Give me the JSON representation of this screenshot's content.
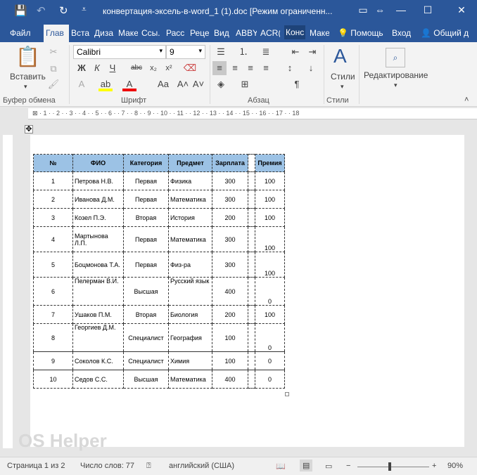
{
  "title": "конвертация-эксель-в-word_1 (1).doc [Режим ограниченн...",
  "tabs": [
    "Файл",
    "Глав",
    "Вста",
    "Диза",
    "Маке",
    "Ссы.",
    "Расс",
    "Реце",
    "Вид",
    "ABBY",
    "ACR(",
    "Конс",
    "Маке"
  ],
  "tell_me": "Помощь",
  "signin": "Вход",
  "share": "Общий д",
  "ribbon": {
    "paste": "Вставить",
    "font_name": "Calibri",
    "font_size": "9",
    "styles": "Стили",
    "editing": "Редактирование",
    "groups": [
      "Буфер обмена",
      "Шрифт",
      "Абзац",
      "Стили"
    ]
  },
  "table": {
    "headers": [
      "№",
      "ФИО",
      "Категория",
      "Предмет",
      "Зарплата",
      "",
      "Премия"
    ],
    "rows": [
      [
        "1",
        "Петрова Н.В.",
        "Первая",
        "Физика",
        "300",
        "",
        "100"
      ],
      [
        "2",
        "Иванова Д.М.",
        "Первая",
        "Математика",
        "300",
        "",
        "100"
      ],
      [
        "3",
        "Козел П.Э.",
        "Вторая",
        "История",
        "200",
        "",
        "100"
      ],
      [
        "4",
        "Мартынова Л.П.",
        "Первая",
        "Математика",
        "300",
        "",
        "100"
      ],
      [
        "5",
        "Боцмонова Т.А.",
        "Первая",
        "Физ-ра",
        "300",
        "",
        "100"
      ],
      [
        "6",
        "Пелерман В.И.",
        "Высшая",
        "Русский язык",
        "400",
        "",
        "0"
      ],
      [
        "7",
        "Ушаков П.М.",
        "Вторая",
        "Биология",
        "200",
        "",
        "100"
      ],
      [
        "8",
        "Георгиев Д.М.",
        "Специалист",
        "География",
        "100",
        "",
        "0"
      ],
      [
        "9",
        "Соколов К.С.",
        "Специалист",
        "Химия",
        "100",
        "",
        "0"
      ],
      [
        "10",
        "Седов С.С.",
        "Высшая",
        "Математика",
        "400",
        "",
        "0"
      ]
    ]
  },
  "status": {
    "page": "Страница 1 из 2",
    "words": "Число слов: 77",
    "language": "английский (США)",
    "zoom": "90%"
  },
  "watermark": "OS Helper"
}
